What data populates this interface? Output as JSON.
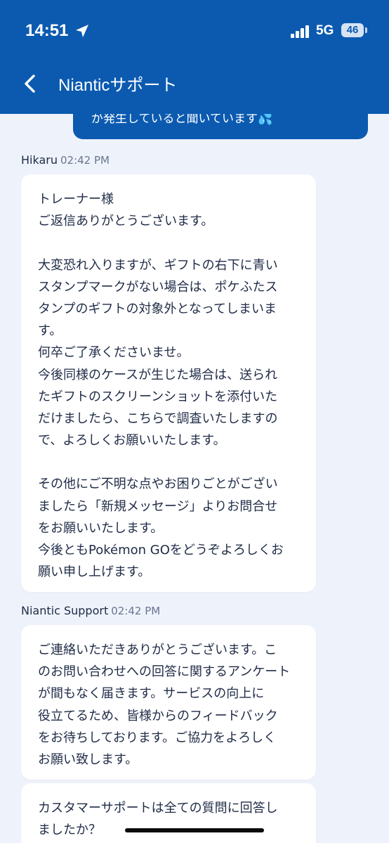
{
  "status_bar": {
    "time": "14:51",
    "network": "5G",
    "battery": "46"
  },
  "header": {
    "title": "Nianticサポート"
  },
  "previous_message": {
    "text": "が発生していると聞いています💦"
  },
  "messages": [
    {
      "sender": "Hikaru",
      "time": "02:42 PM",
      "lines": [
        "トレーナー様",
        "ご返信ありがとうございます。",
        "",
        "大変恐れ入りますが、ギフトの右下に青い",
        "スタンプマークがない場合は、ポケふたス",
        "タンプのギフトの対象外となってしまいま",
        "す。",
        "何卒ご了承くださいませ。",
        "今後同様のケースが生じた場合は、送られ",
        "たギフトのスクリーンショットを添付いた",
        "だけましたら、こちらで調査いたしますの",
        "で、よろしくお願いいたします。",
        "",
        "その他にご不明な点やお困りごとがござい",
        "ましたら「新規メッセージ」よりお問合せ",
        "をお願いいたします。",
        "今後ともPokémon GOをどうぞよろしくお",
        "願い申し上げます。"
      ]
    },
    {
      "sender": "Niantic Support",
      "time": "02:42 PM",
      "lines": [
        "ご連絡いただきありがとうございます。こ",
        "のお問い合わせへの回答に関するアンケート",
        "が間もなく届きます。サービスの向上に",
        "役立てるため、皆様からのフィードバック",
        "をお待ちしております。ご協力をよろしく",
        "お願い致します。"
      ]
    },
    {
      "lines": [
        "カスタマーサポートは全ての質問に回答し",
        "ましたか？"
      ]
    }
  ],
  "colors": {
    "header": "#0b5ab0",
    "background": "#eef3fb",
    "card": "#ffffff",
    "text": "#1f2b46"
  }
}
